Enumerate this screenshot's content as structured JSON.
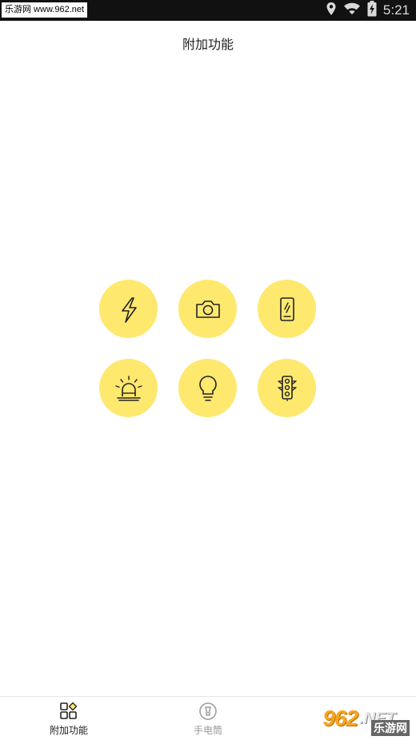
{
  "status_bar": {
    "watermark": "乐游网 www.962.net",
    "time": "5:21"
  },
  "page": {
    "title": "附加功能"
  },
  "features": [
    {
      "icon": "lightning-icon"
    },
    {
      "icon": "camera-icon"
    },
    {
      "icon": "phone-screen-icon"
    },
    {
      "icon": "siren-icon"
    },
    {
      "icon": "lightbulb-icon"
    },
    {
      "icon": "traffic-light-icon"
    }
  ],
  "bottom_nav": {
    "items": [
      {
        "label": "附加功能",
        "icon": "grid-icon",
        "active": true
      },
      {
        "label": "手电筒",
        "icon": "flashlight-icon",
        "active": false
      }
    ]
  },
  "watermark_br": {
    "main": "962",
    "suffix": ".NET",
    "sub": "乐游网"
  },
  "colors": {
    "accent": "#fee86e",
    "icon_stroke": "#222222"
  }
}
